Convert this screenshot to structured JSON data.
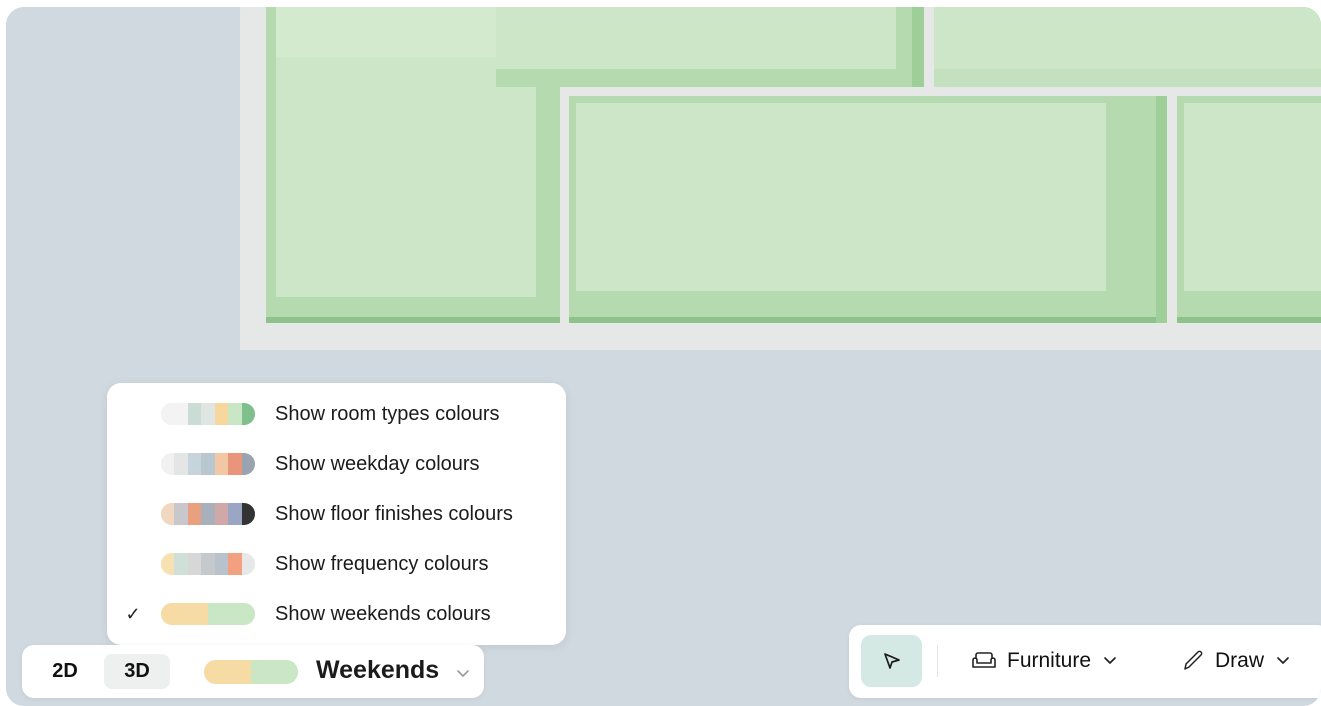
{
  "colour_menu": {
    "items": [
      {
        "label": "Show room types colours",
        "checked": false,
        "colors": [
          "#f3f3f3",
          "#f3f3f3",
          "#c9ddd6",
          "#dfe6e2",
          "#f6d89e",
          "#c9e6c5",
          "#7fbf8c"
        ]
      },
      {
        "label": "Show weekday colours",
        "checked": false,
        "colors": [
          "#f1f1f1",
          "#e4e6e6",
          "#c7d4dc",
          "#b9c7d0",
          "#f2c7a4",
          "#e8957b",
          "#9aa3b0"
        ]
      },
      {
        "label": "Show floor finishes colours",
        "checked": false,
        "colors": [
          "#f2d7c0",
          "#c8c8cc",
          "#e9a07f",
          "#a8b0bc",
          "#d0a8a8",
          "#9aa6c4",
          "#333333"
        ]
      },
      {
        "label": "Show frequency colours",
        "checked": false,
        "colors": [
          "#f7e1b0",
          "#cfe0d8",
          "#d7d7d7",
          "#c5c9cc",
          "#b7c2cc",
          "#f2a07f",
          "#e7e7e7"
        ]
      },
      {
        "label": "Show weekends colours",
        "checked": true,
        "check_mark": "✓",
        "colors": [
          "#f7dba5",
          "#f7dba5",
          "#c9e6c5",
          "#c9e6c5"
        ]
      }
    ]
  },
  "view_bar": {
    "mode_2d": "2D",
    "mode_3d": "3D",
    "active_mode": "3D",
    "colour_mode": "Weekends",
    "swatch_colors": [
      "#f7dba5",
      "#c9e6c5"
    ]
  },
  "toolbar": {
    "select_icon": "cursor-arrow-icon",
    "furniture_label": "Furniture",
    "furniture_icon": "sofa-icon",
    "draw_label": "Draw",
    "draw_icon": "pencil-icon"
  },
  "colors": {
    "canvas_bg": "#d0d9e0",
    "room_fill": "#cde6c8",
    "room_edge": "#b3d9ad",
    "wall": "#e6e8e8",
    "select_highlight": "#d4e8e4"
  }
}
